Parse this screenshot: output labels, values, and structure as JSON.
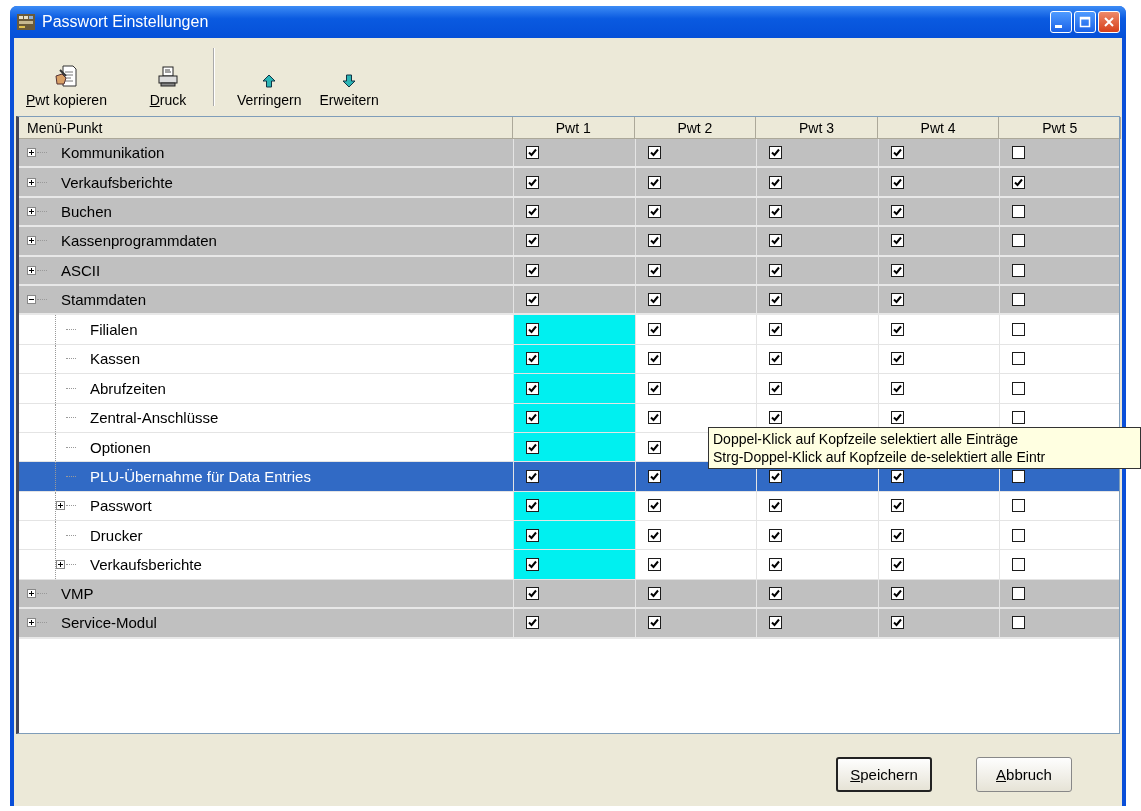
{
  "window": {
    "title": "Passwort Einstellungen"
  },
  "toolbar": [
    {
      "kind": "copy",
      "label": "Pwt kopieren",
      "mnemonic": true
    },
    {
      "kind": "print",
      "label": "Druck",
      "mnemonic": true
    },
    {
      "kind": "up",
      "label": "Verringern",
      "mnemonic": false
    },
    {
      "kind": "down",
      "label": "Erweitern",
      "mnemonic": false
    }
  ],
  "table": {
    "columns": [
      "Menü-Punkt",
      "Pwt 1",
      "Pwt 2",
      "Pwt 3",
      "Pwt 4",
      "Pwt 5"
    ],
    "rows": [
      {
        "label": "Kommunikation",
        "kind": "node",
        "expanded": false,
        "selected": false,
        "checks": [
          true,
          true,
          true,
          true,
          false
        ]
      },
      {
        "label": "Verkaufsberichte",
        "kind": "node",
        "expanded": false,
        "selected": false,
        "checks": [
          true,
          true,
          true,
          true,
          true
        ]
      },
      {
        "label": "Buchen",
        "kind": "node",
        "expanded": false,
        "selected": false,
        "checks": [
          true,
          true,
          true,
          true,
          false
        ]
      },
      {
        "label": "Kassenprogrammdaten",
        "kind": "node",
        "expanded": false,
        "selected": false,
        "checks": [
          true,
          true,
          true,
          true,
          false
        ]
      },
      {
        "label": "ASCII",
        "kind": "node",
        "expanded": false,
        "selected": false,
        "checks": [
          true,
          true,
          true,
          true,
          false
        ]
      },
      {
        "label": "Stammdaten",
        "kind": "node",
        "expanded": true,
        "selected": false,
        "checks": [
          true,
          true,
          true,
          true,
          false
        ],
        "children": [
          {
            "label": "Filialen",
            "kind": "leaf",
            "selected": false,
            "checks": [
              true,
              true,
              true,
              true,
              false
            ],
            "highlight": [
              true,
              false,
              false,
              false,
              false
            ]
          },
          {
            "label": "Kassen",
            "kind": "leaf",
            "selected": false,
            "checks": [
              true,
              true,
              true,
              true,
              false
            ],
            "highlight": [
              true,
              false,
              false,
              false,
              false
            ]
          },
          {
            "label": "Abrufzeiten",
            "kind": "leaf",
            "selected": false,
            "checks": [
              true,
              true,
              true,
              true,
              false
            ],
            "highlight": [
              true,
              false,
              false,
              false,
              false
            ]
          },
          {
            "label": "Zentral-Anschlüsse",
            "kind": "leaf",
            "selected": false,
            "checks": [
              true,
              true,
              true,
              true,
              false
            ],
            "highlight": [
              true,
              false,
              false,
              false,
              false
            ]
          },
          {
            "label": "Optionen",
            "kind": "leaf",
            "selected": false,
            "checks": [
              true,
              true
            ],
            "highlight": [
              true,
              false,
              false,
              false,
              false
            ]
          },
          {
            "label": "PLU-Übernahme für Data Entries",
            "kind": "leaf",
            "selected": true,
            "checks": [
              true,
              true,
              true,
              true,
              false
            ]
          },
          {
            "label": "Passwort",
            "kind": "node",
            "expanded": false,
            "selected": false,
            "checks": [
              true,
              true,
              true,
              true,
              false
            ],
            "highlight": [
              true,
              false,
              false,
              false,
              false
            ]
          },
          {
            "label": "Drucker",
            "kind": "leaf",
            "selected": false,
            "checks": [
              true,
              true,
              true,
              true,
              false
            ],
            "highlight": [
              true,
              false,
              false,
              false,
              false
            ]
          },
          {
            "label": "Verkaufsberichte",
            "kind": "node",
            "expanded": false,
            "selected": false,
            "checks": [
              true,
              true,
              true,
              true,
              false
            ],
            "highlight": [
              true,
              false,
              false,
              false,
              false
            ]
          }
        ]
      },
      {
        "label": "VMP",
        "kind": "node",
        "expanded": false,
        "selected": false,
        "checks": [
          true,
          true,
          true,
          true,
          false
        ]
      },
      {
        "label": "Service-Modul",
        "kind": "node",
        "expanded": false,
        "selected": false,
        "checks": [
          true,
          true,
          true,
          true,
          false
        ]
      }
    ]
  },
  "tooltip": {
    "lines": [
      "Doppel-Klick auf Kopfzeile selektiert alle Einträge",
      "Strg-Doppel-Klick auf Kopfzeile de-selektiert alle Eintr"
    ]
  },
  "buttons": [
    {
      "label": "Speichern",
      "default": true,
      "mnemonic": true
    },
    {
      "label": "Abbruch",
      "default": false,
      "mnemonic": true
    }
  ]
}
